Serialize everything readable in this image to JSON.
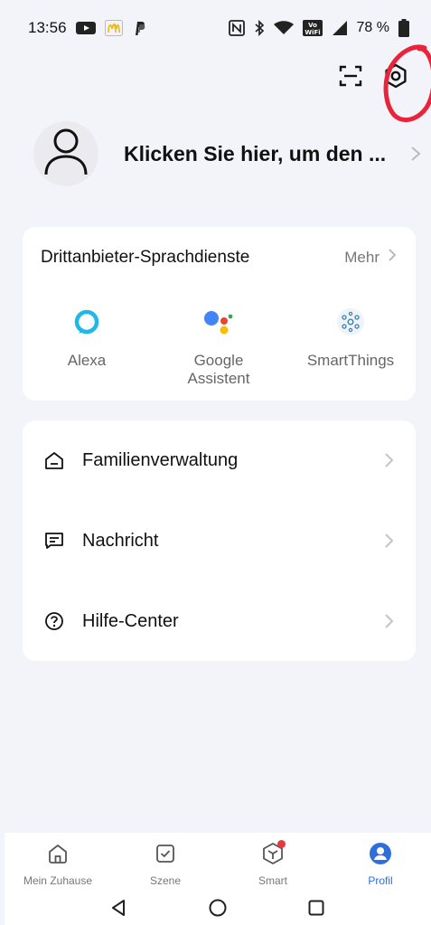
{
  "status_bar": {
    "time": "13:56",
    "battery_percent": "78 %",
    "icons": [
      "youtube-icon",
      "mcdonalds-icon",
      "paypal-icon",
      "nfc-icon",
      "bluetooth-icon",
      "wifi-icon",
      "vowifi-icon",
      "signal-icon",
      "battery-icon"
    ],
    "vowifi_label": "Vo WiFi"
  },
  "header": {
    "icons": [
      "scan-icon",
      "settings-icon"
    ]
  },
  "profile": {
    "login_prompt": "Klicken Sie hier, um den ..."
  },
  "voice_services": {
    "title": "Drittanbieter-Sprachdienste",
    "more_label": "Mehr",
    "items": [
      {
        "label": "Alexa",
        "icon": "alexa-icon"
      },
      {
        "label_line1": "Google",
        "label_line2": "Assistent",
        "icon": "google-assistant-icon"
      },
      {
        "label": "SmartThings",
        "icon": "smartthings-icon"
      }
    ]
  },
  "menu": {
    "items": [
      {
        "label": "Familienverwaltung",
        "icon": "home-icon"
      },
      {
        "label": "Nachricht",
        "icon": "message-icon"
      },
      {
        "label": "Hilfe-Center",
        "icon": "help-icon"
      }
    ]
  },
  "bottom_nav": {
    "items": [
      {
        "label": "Mein Zuhause",
        "icon": "home-icon",
        "active": false
      },
      {
        "label": "Szene",
        "icon": "checkbox-icon",
        "active": false
      },
      {
        "label": "Smart",
        "icon": "cube-icon",
        "active": false,
        "badge": true
      },
      {
        "label": "Profil",
        "icon": "profile-icon",
        "active": true
      }
    ]
  },
  "colors": {
    "background": "#f3f4f9",
    "card": "#ffffff",
    "accent": "#2f6fdc",
    "annotation": "#e8243a",
    "badge": "#e8383d"
  }
}
